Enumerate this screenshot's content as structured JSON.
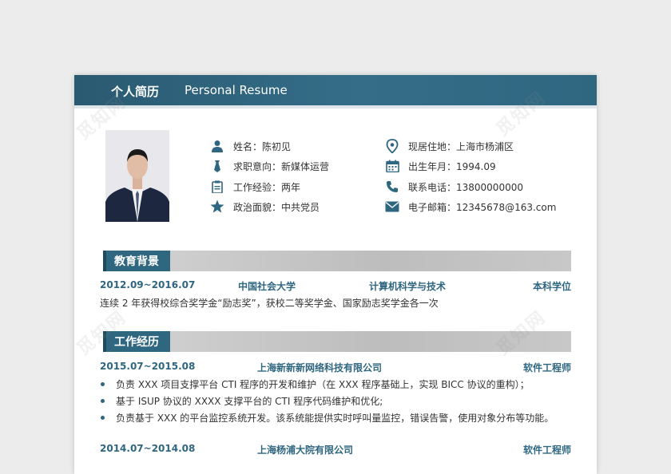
{
  "header": {
    "title": "个人简历",
    "subtitle": "Personal Resume"
  },
  "profile": {
    "name_label": "姓名：陈初见",
    "target_label": "求职意向：新媒体运营",
    "experience_label": "工作经验：两年",
    "politics_label": "政治面貌：中共党员",
    "location_label": "现居住地：上海市杨浦区",
    "birth_label": "出生年月：1994.09",
    "phone_label": "联系电话：13800000000",
    "email_label": "电子邮箱：12345678@163.com"
  },
  "education": {
    "title": "教育背景",
    "period": "2012.09~2016.07",
    "school": "中国社会大学",
    "major": "计算机科学与技术",
    "degree": "本科学位",
    "desc": "连续 2 年获得校综合奖学金“励志奖”，获校二等奖学金、国家励志奖学金各一次"
  },
  "work": {
    "title": "工作经历",
    "jobs": [
      {
        "period": "2015.07~2015.08",
        "company": "上海新新新网络科技有限公司",
        "role": "软件工程师",
        "bullets": [
          "负责 XXX 项目支撑平台 CTI 程序的开发和维护（在 XXX 程序基础上，实现 BICC 协议的重构）；",
          "基于 ISUP 协议的 XXXX 支撑平台的 CTI 程序代码维护和优化;",
          "负责基于 XXX 的平台监控系统开发。该系统能提供实时呼叫量监控，错误告警，使用对象分布等功能。"
        ]
      },
      {
        "period": "2014.07~2014.08",
        "company": "上海杨浦大院有限公司",
        "role": "软件工程师"
      }
    ]
  },
  "watermark_text": "觅知网",
  "colors": {
    "accent": "#2f6680",
    "header": "#2a5a72",
    "section_bar": "#c4c4c4"
  },
  "icons": [
    "person-icon",
    "tie-icon",
    "clipboard-icon",
    "star-icon",
    "location-pin-icon",
    "calendar-icon",
    "phone-icon",
    "envelope-icon"
  ]
}
